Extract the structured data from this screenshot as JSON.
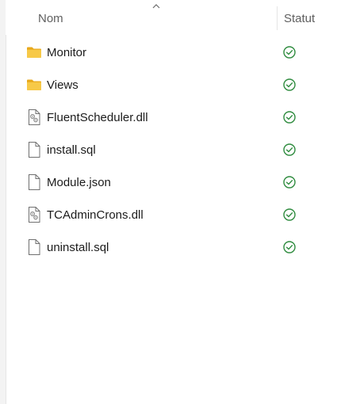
{
  "header": {
    "name_label": "Nom",
    "status_label": "Statut"
  },
  "files": [
    {
      "name": "Monitor",
      "type": "folder",
      "icon": "folder-icon",
      "status": "synced"
    },
    {
      "name": "Views",
      "type": "folder",
      "icon": "folder-icon",
      "status": "synced"
    },
    {
      "name": "FluentScheduler.dll",
      "type": "dll",
      "icon": "dll-file-icon",
      "status": "synced"
    },
    {
      "name": "install.sql",
      "type": "file",
      "icon": "file-icon",
      "status": "synced"
    },
    {
      "name": "Module.json",
      "type": "file",
      "icon": "file-icon",
      "status": "synced"
    },
    {
      "name": "TCAdminCrons.dll",
      "type": "dll",
      "icon": "dll-file-icon",
      "status": "synced"
    },
    {
      "name": "uninstall.sql",
      "type": "file",
      "icon": "file-icon",
      "status": "synced"
    }
  ],
  "colors": {
    "folder": "#f7c948",
    "status_ok": "#2e8b3e",
    "text": "#1b1b1b",
    "header_text": "#5f5f5f"
  }
}
